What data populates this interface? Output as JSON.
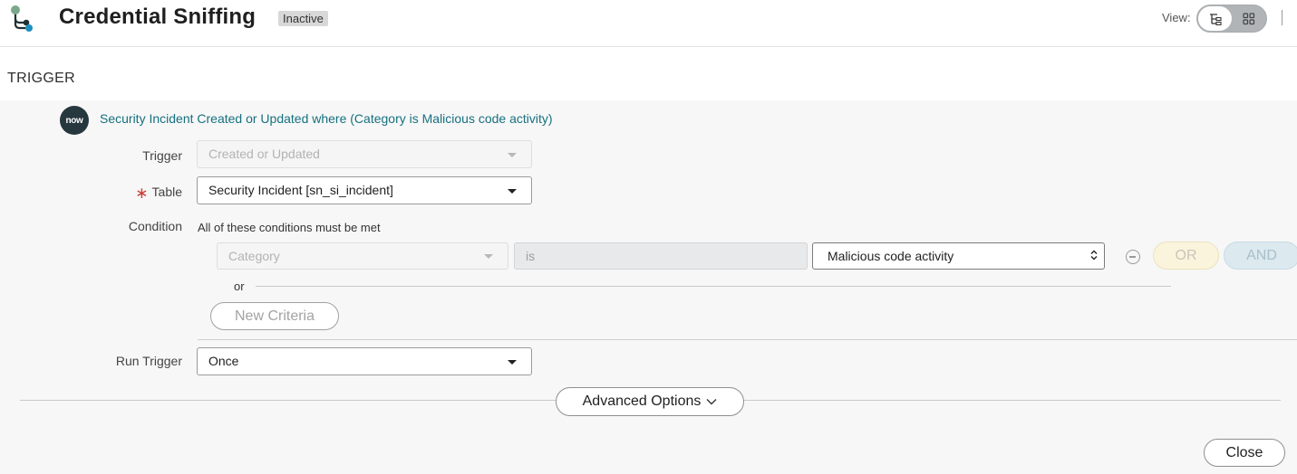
{
  "header": {
    "title": "Credential Sniffing",
    "status_badge": "Inactive",
    "view_label": "View:",
    "view_options": [
      {
        "icon": "tree-view-icon",
        "selected": true
      },
      {
        "icon": "grid-view-icon",
        "selected": false
      }
    ]
  },
  "section": {
    "title": "TRIGGER"
  },
  "trigger_summary": {
    "badge": "now",
    "text": "Security Incident Created or Updated where (Category is Malicious code activity)"
  },
  "form": {
    "trigger": {
      "label": "Trigger",
      "value": "Created or Updated",
      "disabled": true
    },
    "table": {
      "label": "Table",
      "required_marker": "∗",
      "value": "Security Incident [sn_si_incident]"
    },
    "condition": {
      "label": "Condition",
      "caption": "All of these conditions must be met",
      "field": "Category",
      "operator": "is",
      "value": "Malicious code activity",
      "or_button": "OR",
      "and_button": "AND",
      "or_separator": "or",
      "new_criteria_button": "New Criteria"
    },
    "run_trigger": {
      "label": "Run Trigger",
      "value": "Once"
    }
  },
  "footer": {
    "advanced_options_button": "Advanced Options",
    "close_button": "Close"
  },
  "colors": {
    "link": "#16707f",
    "required": "#c83c36",
    "or_button_bg": "#faf4dd",
    "and_button_bg": "#dce9ef",
    "now_badge_bg": "#26383d"
  }
}
